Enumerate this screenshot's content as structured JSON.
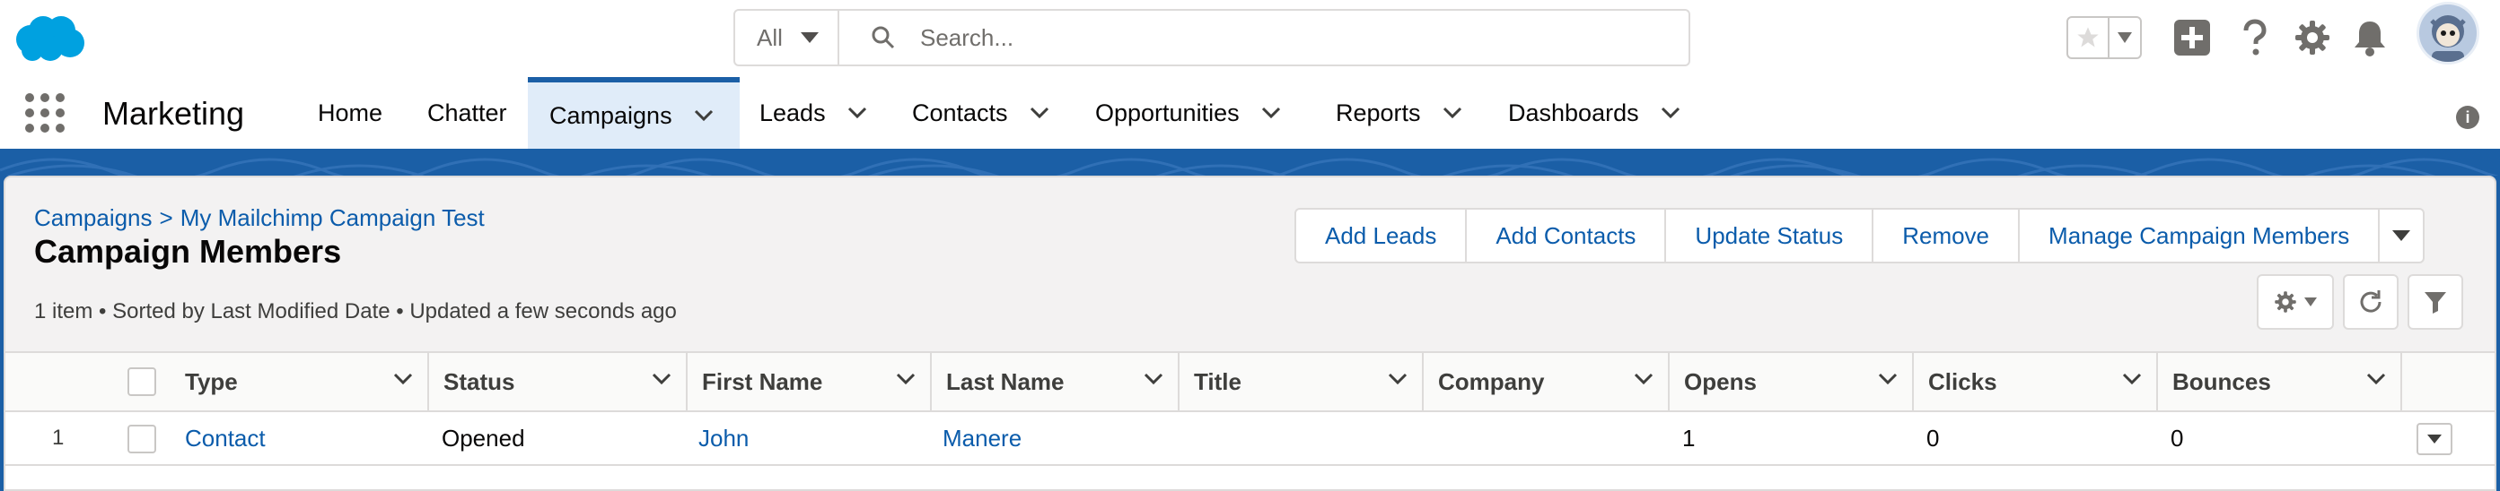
{
  "header": {
    "search_scope": "All",
    "search_placeholder": "Search...",
    "icons": [
      "salesforce-cloud-logo",
      "star-icon",
      "plus-icon",
      "help-icon",
      "gear-icon",
      "bell-icon",
      "avatar"
    ]
  },
  "nav": {
    "app_name": "Marketing",
    "items": [
      {
        "label": "Home",
        "has_menu": false
      },
      {
        "label": "Chatter",
        "has_menu": false
      },
      {
        "label": "Campaigns",
        "has_menu": true,
        "active": true
      },
      {
        "label": "Leads",
        "has_menu": true
      },
      {
        "label": "Contacts",
        "has_menu": true
      },
      {
        "label": "Opportunities",
        "has_menu": true
      },
      {
        "label": "Reports",
        "has_menu": true
      },
      {
        "label": "Dashboards",
        "has_menu": true
      }
    ]
  },
  "page": {
    "breadcrumb": [
      "Campaigns",
      ">",
      "My Mailchimp Campaign Test"
    ],
    "title": "Campaign Members",
    "meta": "1 item • Sorted by Last Modified Date • Updated a few seconds ago",
    "actions": [
      "Add Leads",
      "Add Contacts",
      "Update Status",
      "Remove",
      "Manage Campaign Members"
    ]
  },
  "table": {
    "columns": [
      "Type",
      "Status",
      "First Name",
      "Last Name",
      "Title",
      "Company",
      "Opens",
      "Clicks",
      "Bounces"
    ],
    "rows": [
      {
        "num": "1",
        "type": "Contact",
        "status": "Opened",
        "first_name": "John",
        "last_name": "Manere",
        "title": "",
        "company": "",
        "opens": "1",
        "clicks": "0",
        "bounces": "0"
      }
    ]
  },
  "colors": {
    "brand": "#1b5fa6",
    "link": "#0b5cab",
    "active_tab_bg": "#e0ecf9"
  }
}
